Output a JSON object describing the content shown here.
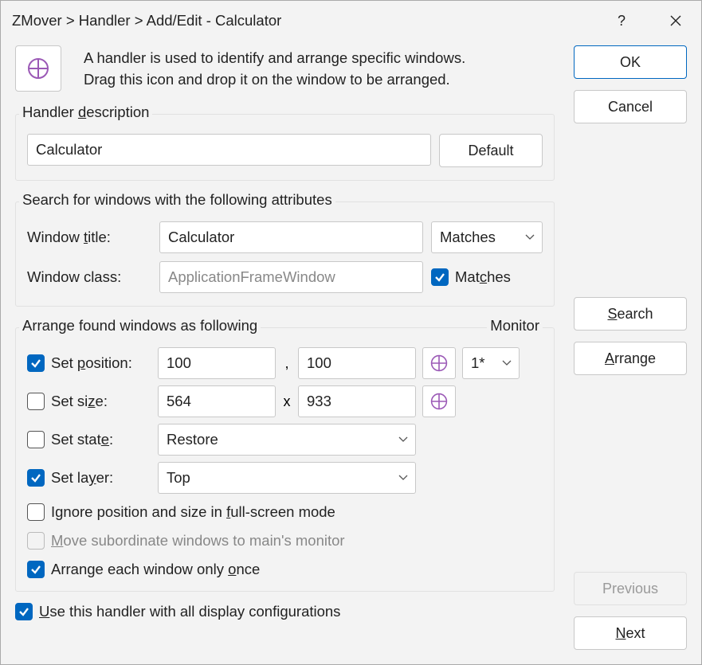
{
  "titlebar": {
    "text": "ZMover > Handler > Add/Edit - Calculator"
  },
  "intro": {
    "line1": "A handler is used to identify and arrange specific windows.",
    "line2": "Drag this icon and drop it on the window to be arranged."
  },
  "buttons": {
    "ok": "OK",
    "cancel": "Cancel",
    "search": "Search",
    "arrange": "Arrange",
    "previous": "Previous",
    "next": "Next",
    "default": "Default"
  },
  "groups": {
    "description_legend": "Handler description",
    "search_legend": "Search for windows with the following attributes",
    "arrange_legend": "Arrange found windows as following",
    "monitor_label": "Monitor"
  },
  "fields": {
    "description_value": "Calculator",
    "window_title_label": "Window title:",
    "window_title_value": "Calculator",
    "window_title_match": "Matches",
    "window_class_label": "Window class:",
    "window_class_value": "ApplicationFrameWindow",
    "window_class_match": "Matches",
    "set_position_label": "Set position:",
    "pos_x": "100",
    "pos_y": "100",
    "monitor_select": "1*",
    "set_size_label": "Set size:",
    "size_w": "564",
    "size_h": "933",
    "set_state_label": "Set state:",
    "state_value": "Restore",
    "set_layer_label": "Set layer:",
    "layer_value": "Top",
    "ignore_fullscreen": "Ignore position and size in full-screen mode",
    "move_subordinate": "Move subordinate windows to main's monitor",
    "arrange_once": "Arrange each window only once",
    "use_all_configs": "Use this handler with all display configurations"
  },
  "separators": {
    "comma": ",",
    "x": "x"
  }
}
